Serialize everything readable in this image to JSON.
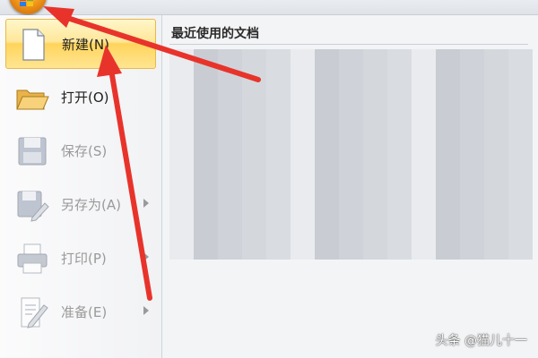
{
  "office_button": {
    "icon": "office-logo-icon"
  },
  "menu": {
    "items": [
      {
        "label": "新建(N)",
        "icon": "new-document-icon",
        "state": "selected",
        "has_submenu": false
      },
      {
        "label": "打开(O)",
        "icon": "open-folder-icon",
        "state": "normal",
        "has_submenu": false
      },
      {
        "label": "保存(S)",
        "icon": "save-disk-icon",
        "state": "disabled",
        "has_submenu": false
      },
      {
        "label": "另存为(A)",
        "icon": "save-as-icon",
        "state": "disabled",
        "has_submenu": true
      },
      {
        "label": "打印(P)",
        "icon": "printer-icon",
        "state": "disabled",
        "has_submenu": true
      },
      {
        "label": "准备(E)",
        "icon": "prepare-document-icon",
        "state": "disabled",
        "has_submenu": true
      }
    ]
  },
  "recent": {
    "title": "最近使用的文档"
  },
  "annotation": {
    "arrow_color": "#e8332b"
  },
  "watermark": {
    "text": "头条 @猫儿十一"
  }
}
